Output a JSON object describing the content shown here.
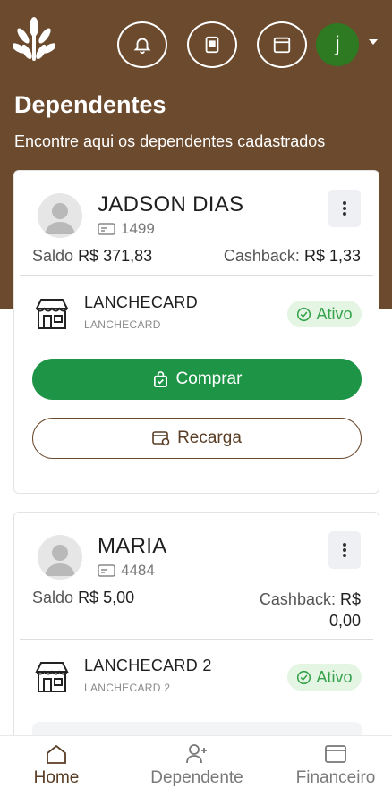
{
  "header": {
    "title": "Dependentes",
    "subtitle": "Encontre aqui os dependentes cadastrados",
    "user_initial": "j",
    "icons": [
      "logo-leaf-icon",
      "bell-icon",
      "wallet-card-icon",
      "calendar-icon"
    ]
  },
  "dependents": [
    {
      "name": "JADSON DIAS",
      "id": "1499",
      "saldo_label": "Saldo",
      "saldo_value": "R$ 371,83",
      "cashback_label": "Cashback:",
      "cashback_value": "R$ 1,33",
      "store_name": "LANCHECARD",
      "store_sub": "LANCHECARD",
      "status": "Ativo",
      "buy_label": "Comprar",
      "recharge_label": "Recarga"
    },
    {
      "name": "MARIA",
      "id": "4484",
      "saldo_label": "Saldo",
      "saldo_value": "R$ 5,00",
      "cashback_label": "Cashback:",
      "cashback_value_line1": "R$",
      "cashback_value_line2": "0,00",
      "store_name": "LANCHECARD 2",
      "store_sub": "LANCHECARD 2",
      "status": "Ativo"
    }
  ],
  "nav": {
    "home": "Home",
    "dependente": "Dependente",
    "financeiro": "Financeiro"
  },
  "colors": {
    "brand_brown": "#6b4a2e",
    "buy_green": "#1d9446",
    "status_green": "#35a24b",
    "avatar_green": "#2d7a22"
  }
}
